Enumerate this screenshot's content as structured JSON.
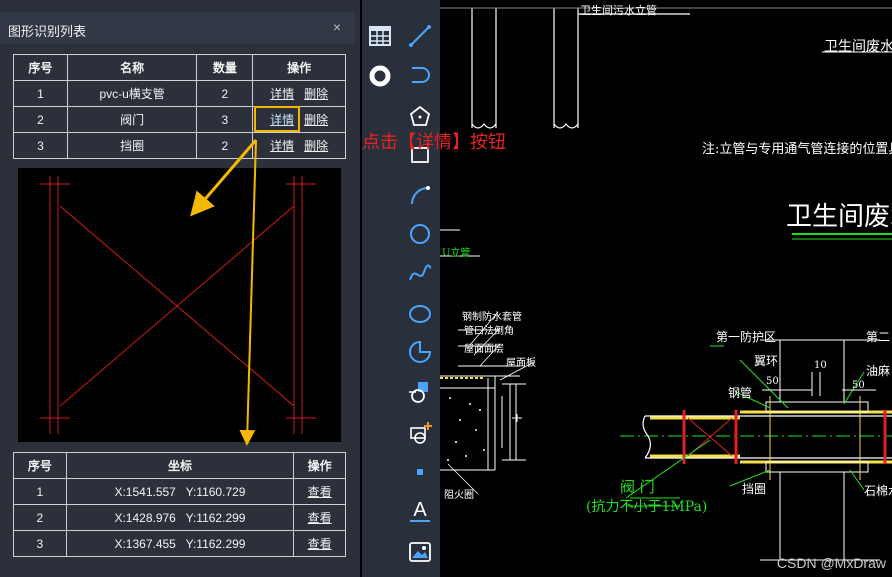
{
  "panel": {
    "title": "图形识别列表",
    "close_glyph": "×"
  },
  "list_table": {
    "headers": [
      "序号",
      "名称",
      "数量",
      "操作"
    ],
    "rows": [
      {
        "index": "1",
        "name": "pvc-u横支管",
        "count": "2",
        "detail": "详情",
        "delete": "删除"
      },
      {
        "index": "2",
        "name": "阀门",
        "count": "3",
        "detail": "详情",
        "delete": "删除"
      },
      {
        "index": "3",
        "name": "挡圈",
        "count": "2",
        "detail": "详情",
        "delete": "删除"
      }
    ]
  },
  "coord_table": {
    "headers": [
      "序号",
      "坐标",
      "操作"
    ],
    "rows": [
      {
        "index": "1",
        "coord": "X:1541.557   Y:1160.729",
        "action": "查看"
      },
      {
        "index": "2",
        "coord": "X:1428.976   Y:1162.299",
        "action": "查看"
      },
      {
        "index": "3",
        "coord": "X:1367.455   Y:1162.299",
        "action": "查看"
      }
    ]
  },
  "toolbar": {
    "tools": [
      "table-icon",
      "circle-fill-icon",
      "line-icon",
      "polyline-icon",
      "polygon-icon",
      "rectangle-icon",
      "arc-icon",
      "circle-icon",
      "spline-icon",
      "ellipse-icon",
      "sector-icon",
      "dimension-icon",
      "add-point-icon",
      "point-icon",
      "text-icon",
      "image-icon"
    ]
  },
  "annotation": "点击【详情】按钮",
  "cad": {
    "texts": {
      "t1": "卫生间废水立",
      "t2": "注:立管与专用通气管连接的位置具体",
      "t3": "卫生间废水",
      "t4": "卫生间污水立管",
      "t5": "第一防护区",
      "t6": "第二",
      "t7": "翼环",
      "t8": "钢管",
      "t9": "油麻",
      "t10": "挡圈",
      "t11": "石棉水",
      "t12": "阀 门",
      "t13": "(抗力不小于1MPa)",
      "t14": "钢制防水套管",
      "t15": "管口法倒角",
      "t16": "屋面面层",
      "t17": "屋面板",
      "t18": "U立管",
      "t19": "阻火圈",
      "t20": "10",
      "t21": "50",
      "t22": "50"
    }
  },
  "watermark": "CSDN @MxDraw",
  "colors": {
    "panel_bg": "#2b303b",
    "highlight": "#f5b800",
    "annotation": "#e8231f",
    "cad_green": "#22e01e",
    "cad_red": "#e02020",
    "cad_yellow": "#f5e04a"
  }
}
